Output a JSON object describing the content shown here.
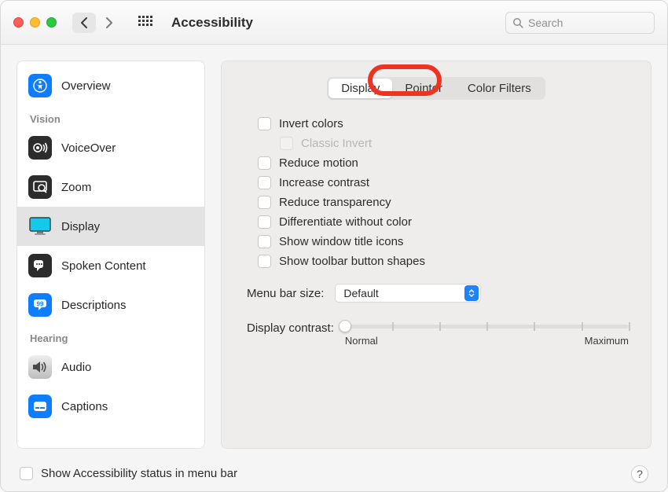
{
  "window": {
    "title": "Accessibility"
  },
  "search": {
    "placeholder": "Search"
  },
  "sidebar": {
    "overview": "Overview",
    "section_vision": "Vision",
    "voiceover": "VoiceOver",
    "zoom": "Zoom",
    "display": "Display",
    "spoken_content": "Spoken Content",
    "descriptions": "Descriptions",
    "section_hearing": "Hearing",
    "audio": "Audio",
    "captions": "Captions"
  },
  "tabs": {
    "display": "Display",
    "pointer": "Pointer",
    "color_filters": "Color Filters"
  },
  "options": {
    "invert_colors": "Invert colors",
    "classic_invert": "Classic Invert",
    "reduce_motion": "Reduce motion",
    "increase_contrast": "Increase contrast",
    "reduce_transparency": "Reduce transparency",
    "differentiate_without_color": "Differentiate without color",
    "show_window_title_icons": "Show window title icons",
    "show_toolbar_button_shapes": "Show toolbar button shapes"
  },
  "menu_bar_size": {
    "label": "Menu bar size:",
    "value": "Default"
  },
  "display_contrast": {
    "label": "Display contrast:",
    "min": "Normal",
    "max": "Maximum"
  },
  "footer": {
    "status_in_menu_bar": "Show Accessibility status in menu bar"
  },
  "annotation": {
    "highlighted_tab": "pointer"
  }
}
